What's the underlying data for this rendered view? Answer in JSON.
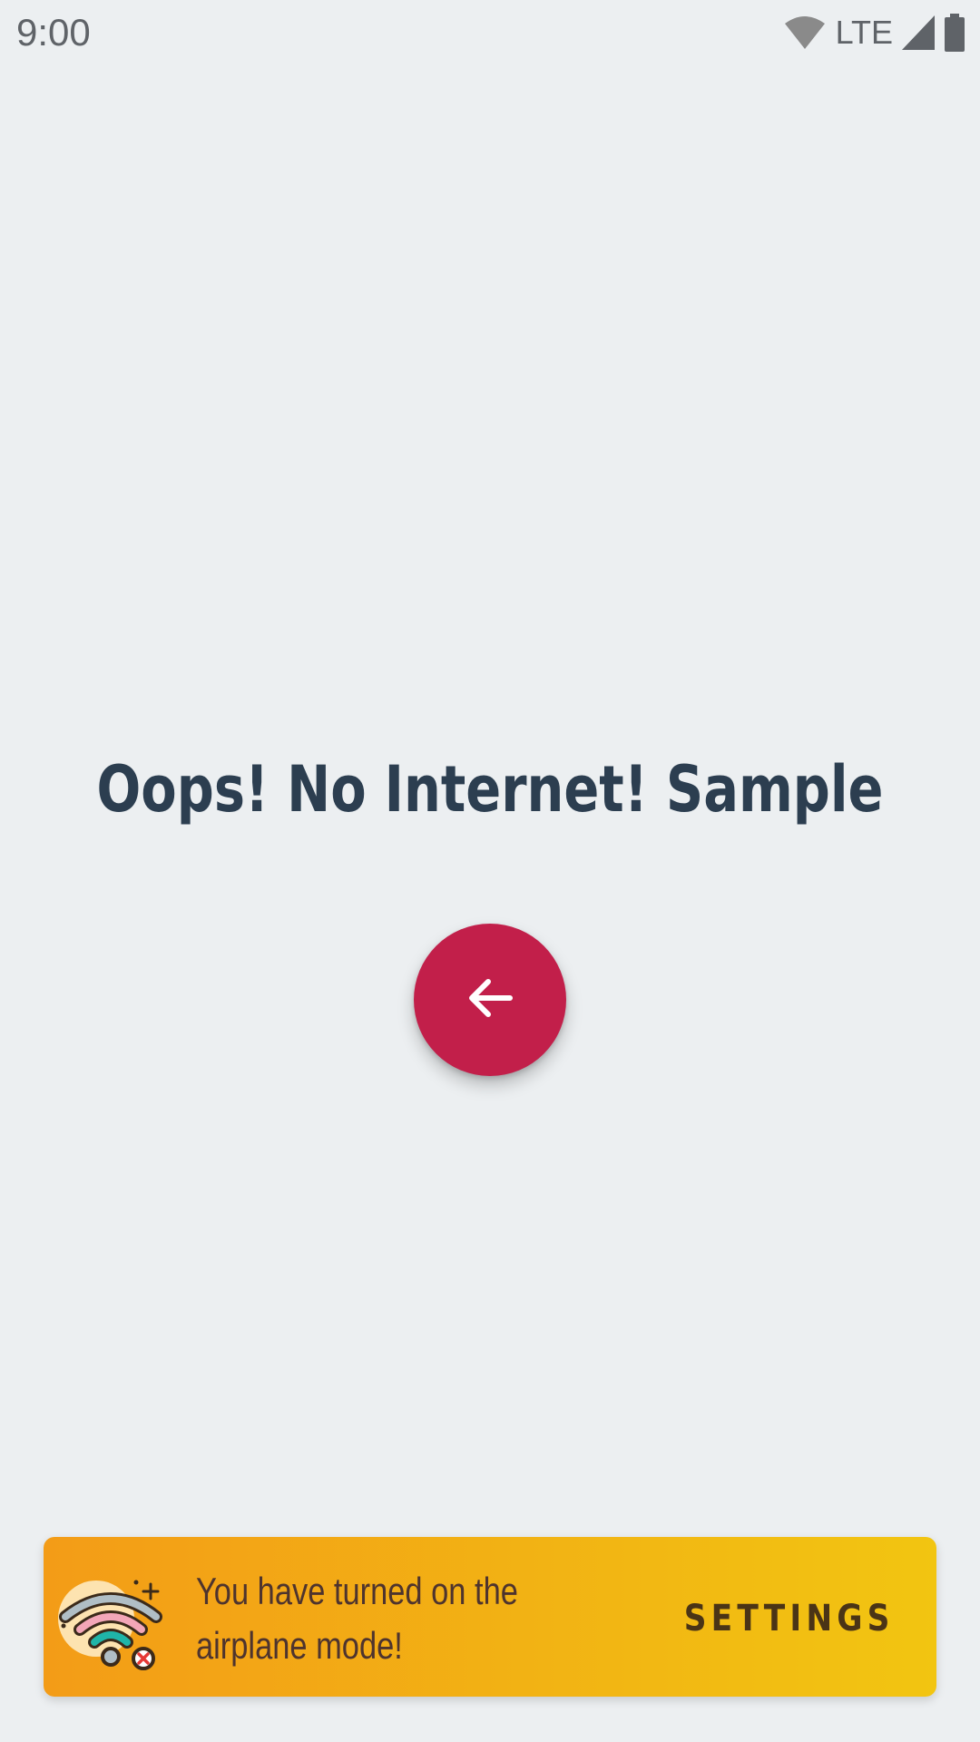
{
  "status_bar": {
    "time": "9:00",
    "network_label": "LTE",
    "icons": [
      "wifi-icon",
      "cell-signal-icon",
      "battery-icon"
    ]
  },
  "main": {
    "title": "Oops! No Internet! Sample",
    "back_button_icon": "arrow-left-icon",
    "back_button_color": "#c21f4a"
  },
  "banner": {
    "icon": "wifi-off-icon",
    "message": "You have turned on the airplane mode!",
    "action_label": "SETTINGS",
    "gradient_start": "#f39c17",
    "gradient_end": "#f2c511"
  },
  "colors": {
    "background": "#eceff1",
    "title_text": "#2c3e50"
  }
}
